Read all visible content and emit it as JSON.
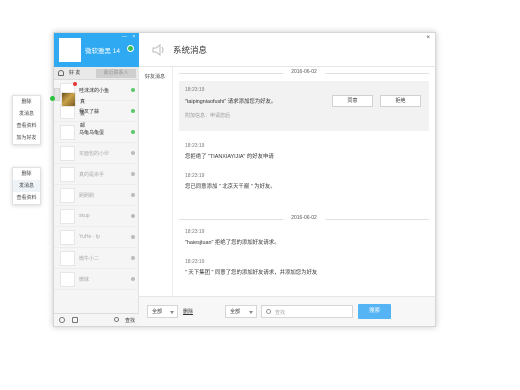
{
  "context_menu_1": {
    "items": [
      "删除",
      "发消息",
      "查看资料",
      "加为好友"
    ]
  },
  "context_menu_2": {
    "items": [
      "删除",
      "发消息",
      "查看资料"
    ]
  },
  "profile": {
    "nickname": "微软雅黑 14",
    "window_buttons": "— ×"
  },
  "tabs": {
    "friends": "好 友",
    "recent": "最近联系人"
  },
  "contacts": [
    {
      "name": "哇沫沫的小鱼",
      "status": "online",
      "unread": true,
      "thumb": "blank"
    },
    {
      "name": "我叉了蒜",
      "status": "online",
      "unread": false,
      "thumb": "blank"
    },
    {
      "name": "真爱邮",
      "status": "online",
      "unread": false,
      "thumb": "photo",
      "selected": true
    },
    {
      "name": "乌龟乌龟蛋",
      "status": "online",
      "unread": false,
      "thumb": "blank"
    },
    {
      "name": "买面包的小伙",
      "status": "offline",
      "unread": false,
      "thumb": "blank"
    },
    {
      "name": "真的是杀手",
      "status": "offline",
      "unread": false,
      "thumb": "blank"
    },
    {
      "name": "刷刷刷",
      "status": "offline",
      "unread": false,
      "thumb": "blank"
    },
    {
      "name": "skup",
      "status": "offline",
      "unread": false,
      "thumb": "blank"
    },
    {
      "name": "YuHe · Ip",
      "status": "offline",
      "unread": false,
      "thumb": "blank"
    },
    {
      "name": "微牛小二",
      "status": "offline",
      "unread": false,
      "thumb": "blank"
    },
    {
      "name": "微妹",
      "status": "offline",
      "unread": false,
      "thumb": "blank"
    }
  ],
  "left_bottom": {
    "find_label": "查找"
  },
  "header": {
    "title": "系统消息",
    "close": "×"
  },
  "subnav": {
    "friend_messages": "好友消息"
  },
  "groups": [
    {
      "date": "2016-06-02",
      "request": {
        "time": "18:23:19",
        "text": "\"taipingniaofushi\" 请求添加您为好友。",
        "extra": "附加信息：申请您后",
        "agree": "同意",
        "reject": "拒绝"
      },
      "messages": [
        {
          "time": "18:23:19",
          "text": "您拒绝了 \"TIANXIAYIJIA\" 的好友申请"
        },
        {
          "time": "18:23:19",
          "text": "您已同意添加 \" 北京天千巅 \" 为好友。"
        }
      ]
    },
    {
      "date": "2016-06-02",
      "messages": [
        {
          "time": "18:23:19",
          "text": "\"haiesjtuan\" 拒绝了您的添加好友请求。"
        },
        {
          "time": "18:23:19",
          "text": "\" 天下集团 \" 同意了您的添加好友请求，并添加您为好友"
        }
      ]
    }
  ],
  "bottom": {
    "filter1": "全部",
    "delete": "删除",
    "filter2": "全部",
    "search_placeholder": "查找",
    "search_button": "搜索"
  },
  "colors": {
    "accent": "#2fa9f2",
    "search_button": "#55b4f4",
    "online": "#3ac150"
  }
}
